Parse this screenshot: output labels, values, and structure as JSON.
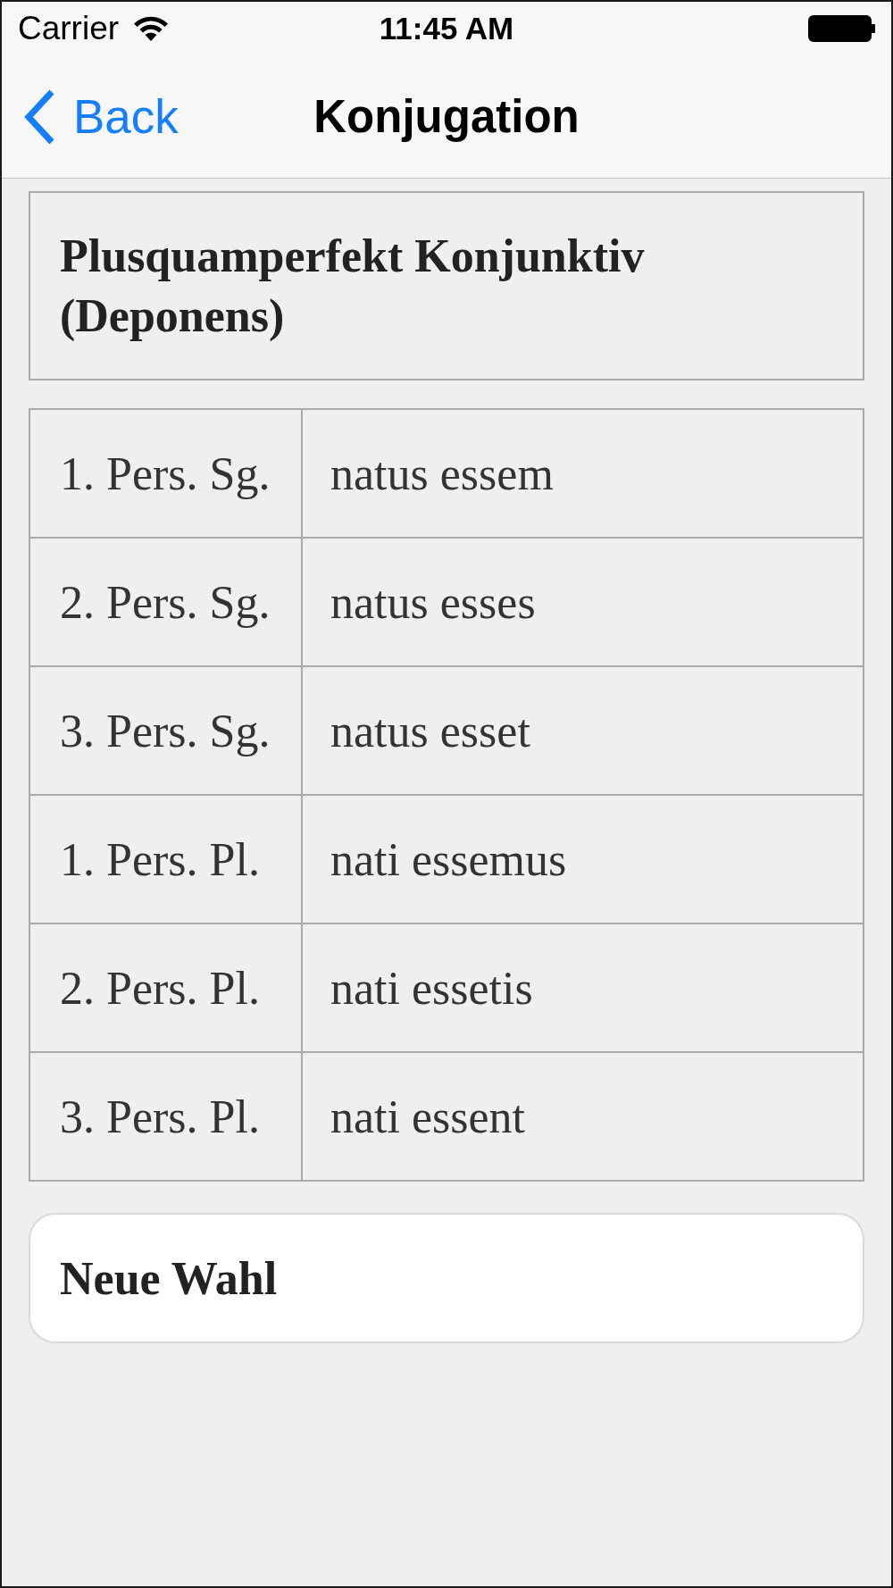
{
  "status_bar": {
    "carrier": "Carrier",
    "time": "11:45 AM"
  },
  "nav_bar": {
    "back_label": "Back",
    "title": "Konjugation"
  },
  "heading": "Plusquamperfekt Konjunktiv (Deponens)",
  "table": {
    "rows": [
      {
        "person": "1. Pers. Sg.",
        "form": "natus essem"
      },
      {
        "person": "2. Pers. Sg.",
        "form": "natus esses"
      },
      {
        "person": "3. Pers. Sg.",
        "form": "natus esset"
      },
      {
        "person": "1. Pers. Pl.",
        "form": "nati essemus"
      },
      {
        "person": "2. Pers. Pl.",
        "form": "nati essetis"
      },
      {
        "person": "3. Pers. Pl.",
        "form": "nati essent"
      }
    ]
  },
  "button": {
    "label": "Neue Wahl"
  }
}
